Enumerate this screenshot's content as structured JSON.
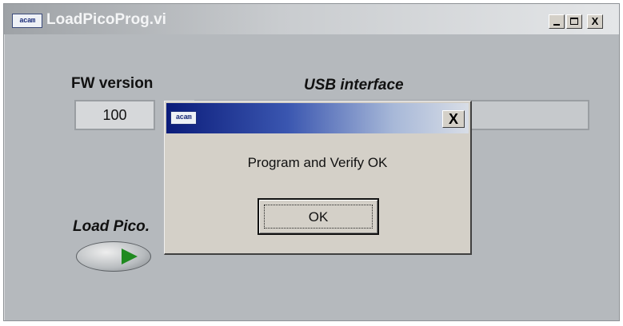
{
  "window": {
    "title": "LoadPicoProg.vi",
    "icon_text": "acam",
    "controls": {
      "minimize": "_",
      "maximize": "□",
      "close": "X"
    }
  },
  "panel": {
    "fw_version_label": "FW version",
    "fw_version_value": "100",
    "usb_interface_label": "USB interface",
    "usb_interface_value": "",
    "load_label": "Load Pico.",
    "load_button_icon": "play-icon"
  },
  "dialog": {
    "icon_text": "acam",
    "close_label": "X",
    "message": "Program and Verify OK",
    "ok_label": "OK"
  },
  "colors": {
    "panel_bg": "#b5b9bd",
    "dialog_bg": "#d4d0c8",
    "dialog_title_start": "#0b1c7a",
    "play_green": "#1f8a1f"
  }
}
